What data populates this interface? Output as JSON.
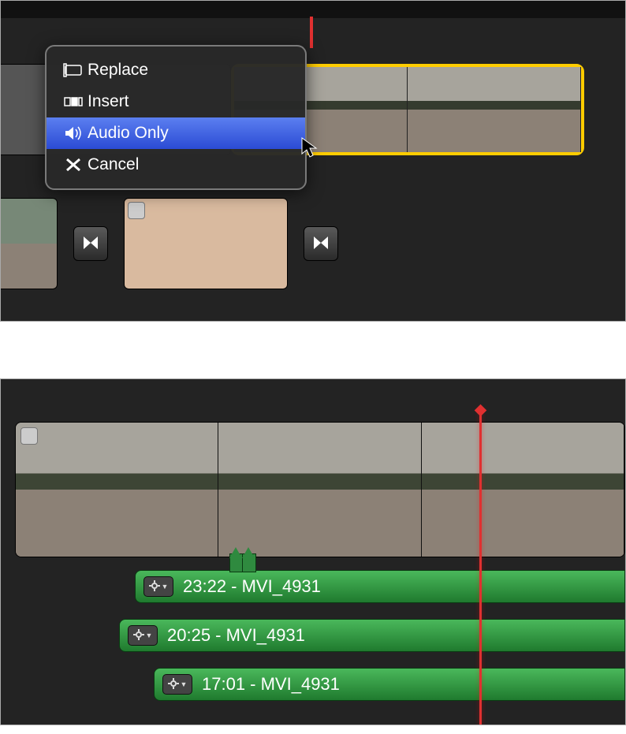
{
  "top_panel": {
    "context_menu": {
      "items": [
        {
          "label": "Replace",
          "icon": "replace-icon",
          "selected": false
        },
        {
          "label": "Insert",
          "icon": "insert-icon",
          "selected": false
        },
        {
          "label": "Audio Only",
          "icon": "speaker-icon",
          "selected": true
        },
        {
          "label": "Cancel",
          "icon": "close-x-icon",
          "selected": false
        }
      ]
    }
  },
  "bottom_panel": {
    "audio_tracks": [
      {
        "label": "23:22 - MVI_4931"
      },
      {
        "label": "20:25 - MVI_4931"
      },
      {
        "label": "17:01 - MVI_4931"
      }
    ]
  }
}
